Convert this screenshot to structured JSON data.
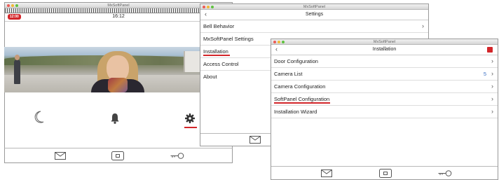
{
  "window_main": {
    "title": "MxSoftPanel",
    "badge": "12:00",
    "time": "16:12",
    "icons": [
      "moon-icon",
      "bell-icon",
      "gear-icon"
    ],
    "bottom_icons": [
      "mail-icon",
      "camera-icon",
      "key-icon"
    ]
  },
  "window_settings": {
    "title": "MxSoftPanel",
    "header": "Settings",
    "items": [
      {
        "label": "Bell Behavior"
      },
      {
        "label": "MxSoftPanel Settings"
      },
      {
        "label": "Installation"
      },
      {
        "label": "Access Control"
      },
      {
        "label": "About"
      }
    ]
  },
  "window_installation": {
    "title": "MxSoftPanel",
    "header": "Installation",
    "items": [
      {
        "label": "Door Configuration",
        "count": ""
      },
      {
        "label": "Camera List",
        "count": "5"
      },
      {
        "label": "Camera Configuration",
        "count": ""
      },
      {
        "label": "SoftPanel Configuration",
        "count": ""
      },
      {
        "label": "Installation Wizard",
        "count": ""
      }
    ]
  },
  "accent_color": "#d3262a"
}
